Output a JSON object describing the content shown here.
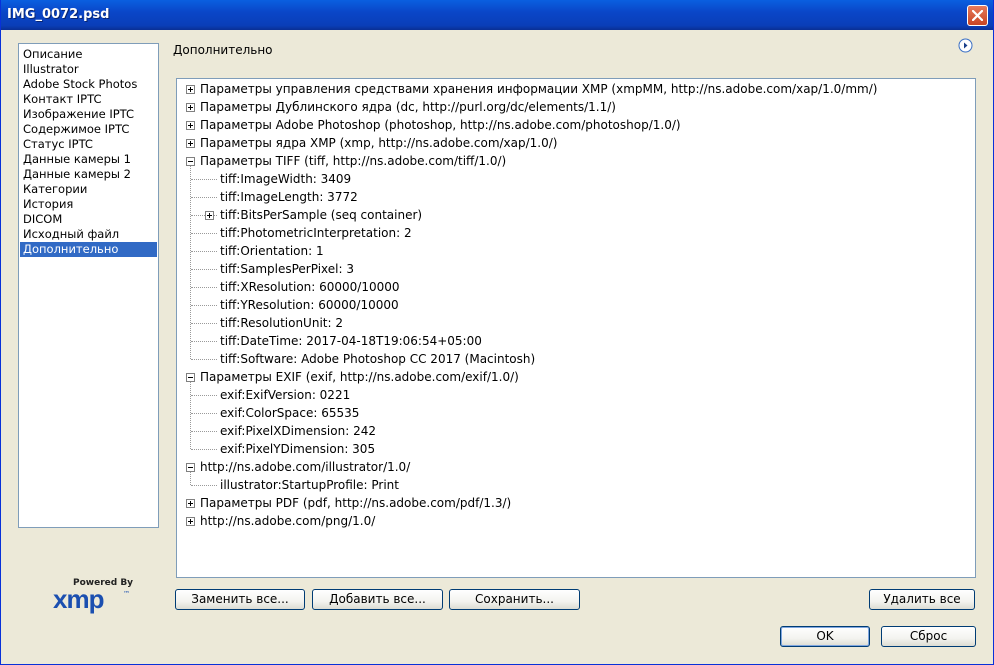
{
  "window": {
    "title": "IMG_0072.psd"
  },
  "sidebar": {
    "items": [
      {
        "label": "Описание"
      },
      {
        "label": "Illustrator"
      },
      {
        "label": "Adobe Stock Photos"
      },
      {
        "label": "Контакт IPTC"
      },
      {
        "label": "Изображение IPTC"
      },
      {
        "label": "Содержимое IPTC"
      },
      {
        "label": "Статус IPTC"
      },
      {
        "label": "Данные камеры 1"
      },
      {
        "label": "Данные камеры 2"
      },
      {
        "label": "Категории"
      },
      {
        "label": "История"
      },
      {
        "label": "DICOM"
      },
      {
        "label": "Исходный файл"
      },
      {
        "label": "Дополнительно",
        "selected": true
      }
    ],
    "logo": {
      "powered_by": "Powered By",
      "brand": "xmp",
      "trademark": "™"
    }
  },
  "main": {
    "title": "Дополнительно",
    "tree": [
      {
        "label": "Параметры управления средствами хранения информации XMP (xmpMM, http://ns.adobe.com/xap/1.0/mm/)",
        "level": 0,
        "expanded": false
      },
      {
        "label": "Параметры Дублинского ядра (dc, http://purl.org/dc/elements/1.1/)",
        "level": 0,
        "expanded": false
      },
      {
        "label": "Параметры Adobe Photoshop (photoshop, http://ns.adobe.com/photoshop/1.0/)",
        "level": 0,
        "expanded": false
      },
      {
        "label": "Параметры ядра XMP (xmp, http://ns.adobe.com/xap/1.0/)",
        "level": 0,
        "expanded": false
      },
      {
        "label": "Параметры TIFF (tiff, http://ns.adobe.com/tiff/1.0/)",
        "level": 0,
        "expanded": true
      },
      {
        "label": "tiff:ImageWidth: 3409",
        "level": 1
      },
      {
        "label": "tiff:ImageLength: 3772",
        "level": 1
      },
      {
        "label": "tiff:BitsPerSample (seq container)",
        "level": 1,
        "expanded": false
      },
      {
        "label": "tiff:PhotometricInterpretation: 2",
        "level": 1
      },
      {
        "label": "tiff:Orientation: 1",
        "level": 1
      },
      {
        "label": "tiff:SamplesPerPixel: 3",
        "level": 1
      },
      {
        "label": "tiff:XResolution: 60000/10000",
        "level": 1
      },
      {
        "label": "tiff:YResolution: 60000/10000",
        "level": 1
      },
      {
        "label": "tiff:ResolutionUnit: 2",
        "level": 1
      },
      {
        "label": "tiff:DateTime: 2017-04-18T19:06:54+05:00",
        "level": 1
      },
      {
        "label": "tiff:Software: Adobe Photoshop CC 2017 (Macintosh)",
        "level": 1
      },
      {
        "label": "Параметры EXIF (exif, http://ns.adobe.com/exif/1.0/)",
        "level": 0,
        "expanded": true
      },
      {
        "label": "exif:ExifVersion: 0221",
        "level": 1
      },
      {
        "label": "exif:ColorSpace: 65535",
        "level": 1
      },
      {
        "label": "exif:PixelXDimension: 242",
        "level": 1
      },
      {
        "label": "exif:PixelYDimension: 305",
        "level": 1
      },
      {
        "label": "http://ns.adobe.com/illustrator/1.0/",
        "level": 0,
        "expanded": true
      },
      {
        "label": "illustrator:StartupProfile: Print",
        "level": 1
      },
      {
        "label": "Параметры PDF (pdf, http://ns.adobe.com/pdf/1.3/)",
        "level": 0,
        "expanded": false
      },
      {
        "label": "http://ns.adobe.com/png/1.0/",
        "level": 0,
        "expanded": false
      }
    ]
  },
  "buttons": {
    "replace_all": "Заменить все...",
    "append_all": "Добавить все...",
    "save": "Сохранить...",
    "delete_all": "Удалить все",
    "ok": "OK",
    "reset": "Сброс"
  },
  "icons": {
    "close": "close-icon",
    "flyout": "flyout-menu-icon"
  }
}
